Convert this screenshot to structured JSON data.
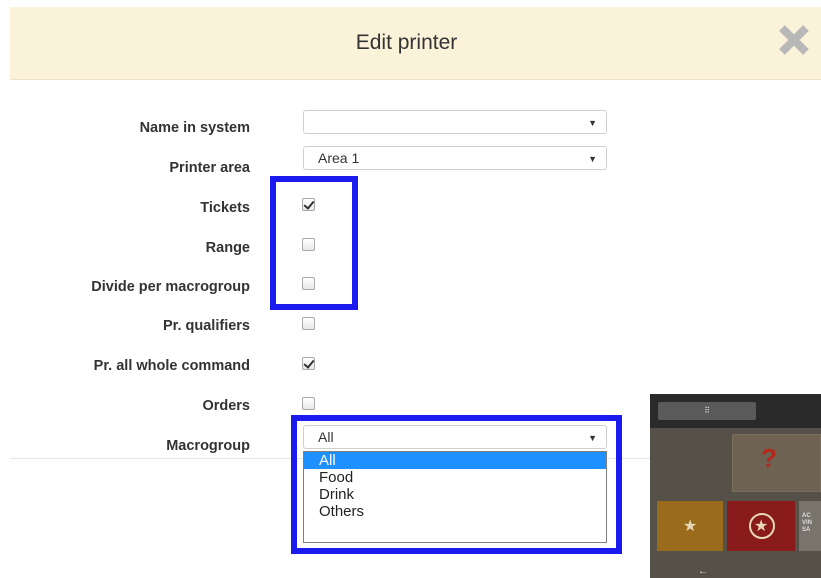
{
  "modal": {
    "title": "Edit printer",
    "close_icon": "close-icon"
  },
  "form": {
    "name_in_system": {
      "label": "Name in system",
      "value": ""
    },
    "printer_area": {
      "label": "Printer area",
      "value": "Area 1"
    },
    "tickets": {
      "label": "Tickets",
      "checked": true
    },
    "range": {
      "label": "Range",
      "checked": false
    },
    "divide_per_macrogroup": {
      "label": "Divide per macrogroup",
      "checked": false
    },
    "pr_qualifiers": {
      "label": "Pr. qualifiers",
      "checked": false
    },
    "pr_all_whole_command": {
      "label": "Pr. all whole command",
      "checked": true
    },
    "orders": {
      "label": "Orders",
      "checked": false
    },
    "macrogroup": {
      "label": "Macrogroup",
      "value": "All",
      "options": [
        "All",
        "Food",
        "Drink",
        "Others"
      ],
      "selected_index": 0
    }
  },
  "colors": {
    "header_bg": "#fbf2da",
    "highlight": "#1b1bf0",
    "option_selected": "#1e90ff"
  },
  "preview_panel": {
    "btn3_text": "AC VIN SA"
  }
}
